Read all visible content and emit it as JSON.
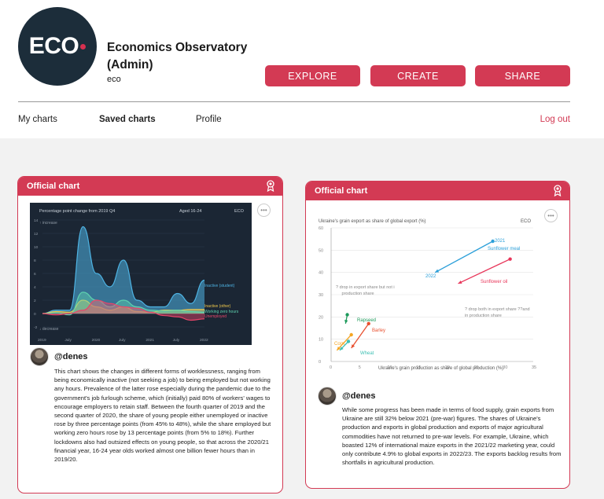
{
  "header": {
    "logo_text": "ECO",
    "org_name": "Economics Observatory (Admin)",
    "org_handle": "eco",
    "buttons": {
      "explore": "EXPLORE",
      "create": "CREATE",
      "share": "SHARE"
    }
  },
  "nav": {
    "my_charts": "My charts",
    "saved_charts": "Saved charts",
    "profile": "Profile",
    "logout": "Log out"
  },
  "colors": {
    "accent": "#d33a54",
    "logo_bg": "#1c2d3a",
    "chart_dark_bg": "#1b2634"
  },
  "cards": [
    {
      "badge": "Official chart",
      "author": "@denes",
      "description": "This chart shows the changes in different forms of worklessness, ranging from being economically inactive (not seeking a job) to being employed but not working any hours. Prevalence of the latter rose especially during the pandemic due to the government's job furlough scheme, which (initially) paid 80% of workers' wages to encourage employers to retain staff. Between the fourth quarter of 2019 and the second quarter of 2020, the share of young people either unemployed or inactive rose by three percentage points (from 45% to 48%), while the share employed but working zero hours rose by 13 percentage points (from 5% to 18%). Further lockdowns also had outsized effects on young people, so that across the 2020/21 financial year, 16-24 year olds worked almost one billion fewer hours than in 2019/20.",
      "chart": {
        "title": "Percentage point change from 2019 Q4",
        "subtitle": "Aged 16-24",
        "brand": "ECO",
        "increase_label": "↑ increase",
        "decrease_label": "↓ decrease",
        "y_ticks": [
          "14",
          "12",
          "10",
          "8",
          "6",
          "4",
          "2",
          "0",
          "-2"
        ],
        "x_ticks": [
          "2019",
          "July",
          "2020",
          "July",
          "2021",
          "July",
          "2022"
        ],
        "series_labels": [
          "Inactive (student)",
          "Inactive (other)",
          "Working zero hours",
          "Unemployed"
        ]
      }
    },
    {
      "badge": "Official chart",
      "author": "@denes",
      "description": "While some progress has been made in terms of food supply, grain exports from Ukraine are still 32% below 2021 (pre-war) figures. The shares of Ukraine's production and exports in global production and exports of major agricultural commodities have not returned to pre-war levels. For example, Ukraine, which boasted 12% of international maize exports in the 2021/22 marketing year, could only contribute 4.9% to global exports in 2022/23. The exports backlog results from shortfalls in agricultural production.",
      "chart": {
        "title": "Ukraine's grain export as share of global export (%)",
        "xlabel": "Ukraine's grain production as share of global production (%)",
        "brand": "ECO",
        "y_ticks": [
          "60",
          "50",
          "40",
          "30",
          "20",
          "10",
          "0"
        ],
        "x_ticks": [
          "0",
          "5",
          "10",
          "15",
          "20",
          "25",
          "30",
          "35"
        ],
        "annotation_top": "? drop in export share but not in production share",
        "annotation_right": "? drop both in export share ??and in production share",
        "labels": {
          "y2021": "2021",
          "y2022": "2022",
          "sunflower_meal": "Sunflower meal",
          "sunflower_oil": "Sunflower oil",
          "rapseed": "Rapseed",
          "barley": "Barley",
          "corn": "Corn",
          "wheat": "Wheat"
        }
      }
    }
  ],
  "chart_data": [
    {
      "type": "area",
      "title": "Percentage point change from 2019 Q4",
      "subtitle": "Aged 16-24",
      "x": [
        "2019",
        "July",
        "2020",
        "July",
        "2021",
        "July",
        "2022"
      ],
      "ylim": [
        -2,
        14
      ],
      "series": [
        {
          "name": "Inactive (student)",
          "values": [
            0,
            0.5,
            0.5,
            13,
            6,
            4,
            8,
            2,
            1,
            1,
            3,
            1.5,
            5
          ]
        },
        {
          "name": "Inactive (other)",
          "values": [
            0,
            0.3,
            0.2,
            2,
            1,
            0.5,
            1,
            0.3,
            0.2,
            0.5,
            0.5,
            0.6,
            0.6
          ]
        },
        {
          "name": "Working zero hours",
          "values": [
            0,
            0.1,
            -0.2,
            3.2,
            2,
            1,
            2,
            1,
            0.5,
            0.4,
            0.5,
            0.3,
            0.2
          ]
        },
        {
          "name": "Unemployed",
          "values": [
            0,
            -0.2,
            0,
            0.5,
            2,
            1.5,
            1,
            0.8,
            0.2,
            -0.3,
            -0.5,
            -1,
            -0.8
          ]
        }
      ]
    },
    {
      "type": "scatter",
      "title": "Ukraine's grain export as share of global export (%)",
      "xlabel": "Ukraine's grain production as share of global production (%)",
      "ylabel": "",
      "xlim": [
        0,
        35
      ],
      "ylim": [
        0,
        60
      ],
      "series": [
        {
          "name": "Sunflower meal",
          "x": [
            18,
            28
          ],
          "y": [
            40,
            54
          ]
        },
        {
          "name": "Sunflower oil",
          "x": [
            22,
            31
          ],
          "y": [
            35,
            46
          ]
        },
        {
          "name": "Rapseed",
          "x": [
            2.5,
            2.8
          ],
          "y": [
            17,
            21
          ]
        },
        {
          "name": "Barley",
          "x": [
            3.5,
            6.5
          ],
          "y": [
            6,
            17
          ]
        },
        {
          "name": "Corn",
          "x": [
            1,
            3.5
          ],
          "y": [
            5,
            12
          ]
        },
        {
          "name": "Wheat",
          "x": [
            1.5,
            3
          ],
          "y": [
            5,
            9
          ]
        }
      ]
    }
  ]
}
